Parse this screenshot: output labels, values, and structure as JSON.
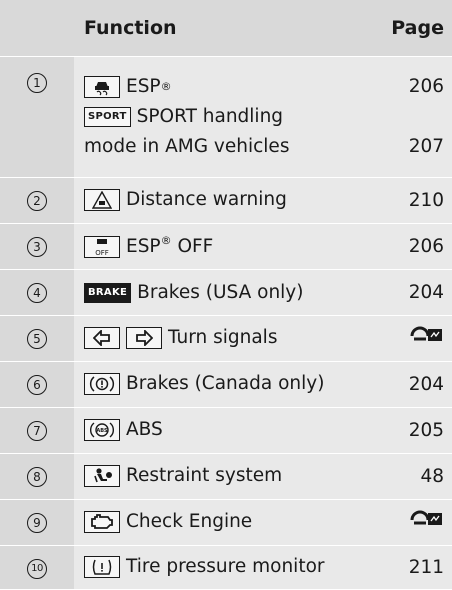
{
  "header": {
    "function": "Function",
    "page": "Page"
  },
  "rows": [
    {
      "num": "1",
      "lines": [
        "ESP",
        "SPORT handling",
        "mode in AMG vehicles"
      ],
      "pages": [
        "206",
        "207"
      ],
      "sport_badge": "SPORT"
    },
    {
      "num": "2",
      "label": "Distance warning",
      "page": "210"
    },
    {
      "num": "3",
      "label": "ESP",
      "label_suffix": " OFF",
      "page": "206",
      "icon_text": "OFF"
    },
    {
      "num": "4",
      "label": "Brakes (USA only)",
      "page": "204",
      "badge": "BRAKE"
    },
    {
      "num": "5",
      "label": "Turn signals",
      "page_icon": "steering-wheel-display-icon"
    },
    {
      "num": "6",
      "label": "Brakes (Canada only)",
      "page": "204"
    },
    {
      "num": "7",
      "label": "ABS",
      "page": "205",
      "icon_text": "ABS"
    },
    {
      "num": "8",
      "label": "Restraint system",
      "page": "48"
    },
    {
      "num": "9",
      "label": "Check Engine",
      "page_icon": "steering-wheel-display-icon"
    },
    {
      "num": "10",
      "label": "Tire pressure monitor",
      "page": "211"
    }
  ],
  "registered_mark": "®"
}
